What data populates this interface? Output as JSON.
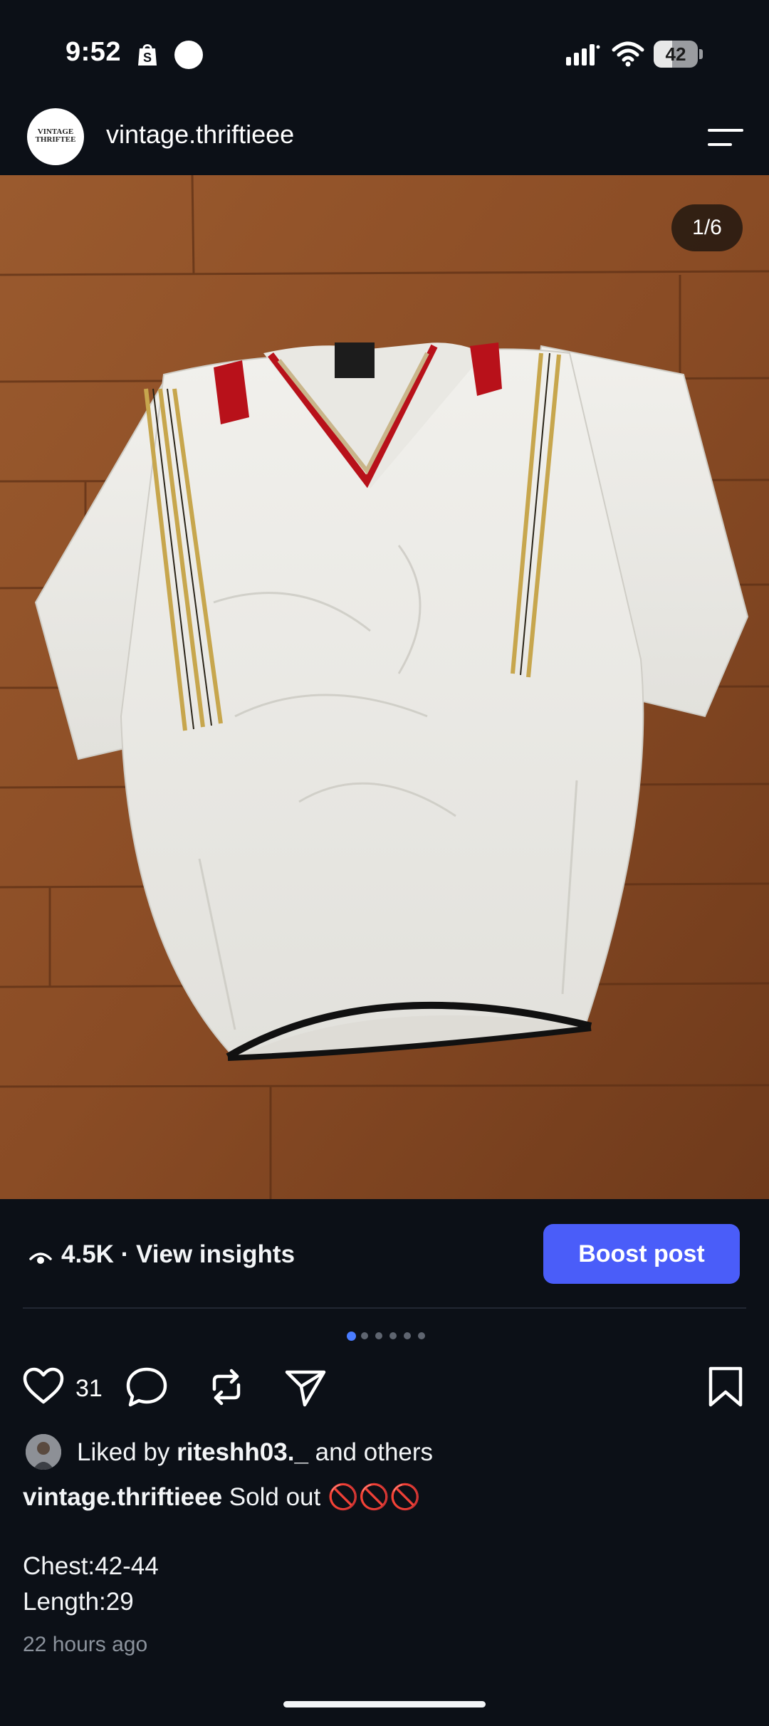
{
  "status_bar": {
    "time": "9:52",
    "battery_level": "42",
    "icons": [
      "shopify-icon",
      "circle-dot-icon",
      "signal-icon",
      "wifi-icon",
      "battery-icon"
    ]
  },
  "header": {
    "username": "vintage.thriftieee",
    "logo_text_top": "VINTAGE",
    "logo_text_bottom": "THRIFTEE",
    "menu_icon": "hamburger-menu-icon"
  },
  "post": {
    "page_counter": "1/6",
    "image_subject": "white short-sleeve windbreaker pullover on wooden floor",
    "carousel_total": 6,
    "carousel_active": 0
  },
  "insights": {
    "views_text": "4.5K · View insights",
    "boost_label": "Boost post"
  },
  "actions": {
    "like_count": "31"
  },
  "caption": {
    "liked_prefix": "Liked by ",
    "liked_user": "riteshh03._",
    "liked_suffix": " and others",
    "author": "vintage.thriftieee",
    "text": " Sold out 🚫🚫🚫",
    "line_chest": "Chest:42-44",
    "line_length": "Length:29",
    "time_ago": "22 hours ago"
  },
  "colors": {
    "background": "#0c1017",
    "accent": "#4a5df9",
    "active_dot": "#4a7cff",
    "muted_text": "#8b929c"
  }
}
